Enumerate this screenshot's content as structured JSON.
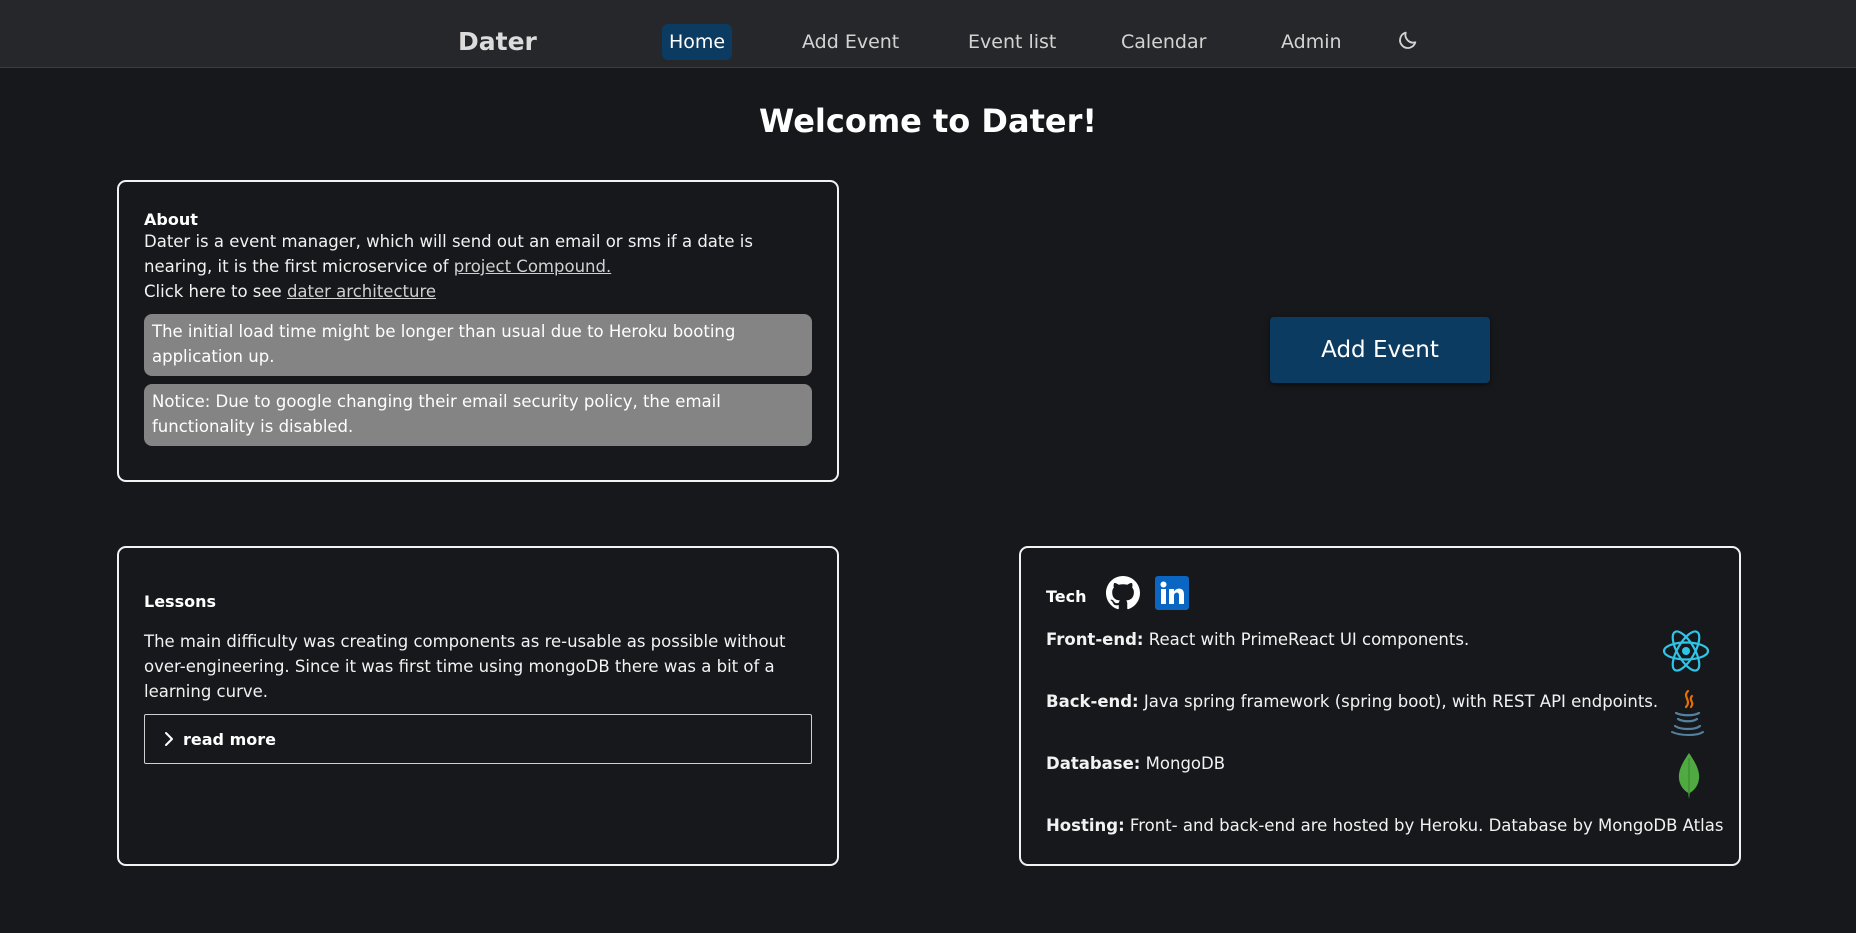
{
  "navbar": {
    "brand": "Dater",
    "items": [
      {
        "label": "Home",
        "active": true
      },
      {
        "label": "Add Event",
        "active": false
      },
      {
        "label": "Event list",
        "active": false
      },
      {
        "label": "Calendar",
        "active": false
      },
      {
        "label": "Admin",
        "active": false
      }
    ],
    "theme_icon": "moon-icon"
  },
  "main": {
    "title": "Welcome to Dater!"
  },
  "about": {
    "heading": "About",
    "text_before_link": "Dater is a event manager, which will send out an email or sms if a date is nearing, it is the first microservice of ",
    "project_link": "project Compound.",
    "arch_prefix": "Click here to see ",
    "arch_link": "dater architecture",
    "notices": [
      "The initial load time might be longer than usual due to Heroku booting application up.",
      "Notice: Due to google changing their email security policy, the email functionality is disabled."
    ]
  },
  "add_event_button": "Add Event",
  "lessons": {
    "heading": "Lessons",
    "text": "The main difficulty was creating components as re-usable as possible without over-engineering. Since it was first time using mongoDB there was a bit of a learning curve.",
    "read_more": "read more"
  },
  "tech": {
    "heading": "Tech",
    "icons": [
      "github-icon",
      "linkedin-icon",
      "react-icon",
      "java-icon",
      "mongodb-icon"
    ],
    "rows": [
      {
        "label": "Front-end:",
        "value": " React with PrimeReact UI components."
      },
      {
        "label": "Back-end:",
        "value": " Java spring framework (spring boot), with REST API endpoints."
      },
      {
        "label": "Database:",
        "value": " MongoDB"
      },
      {
        "label": "Hosting:",
        "value": " Front- and back-end are hosted by Heroku. Database by MongoDB Atlas"
      }
    ]
  },
  "colors": {
    "background": "#17181b",
    "navbar": "#26272a",
    "accent": "#0c3b61",
    "notice": "#848484"
  }
}
